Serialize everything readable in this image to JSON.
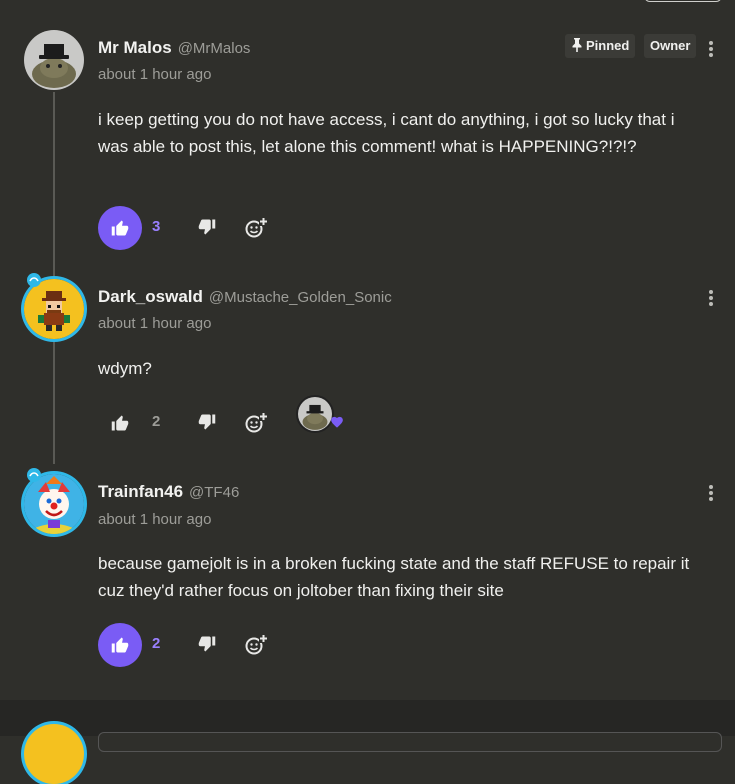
{
  "comments": [
    {
      "name": "Mr Malos",
      "handle": "@MrMalos",
      "time": "about 1 hour ago",
      "text": "i keep getting you do not have access, i cant do anything, i got so lucky that i was able to post this, let alone this comment! what is HAPPENING?!?!?",
      "likes": "3",
      "liked": true,
      "tags": {
        "pinned": "Pinned",
        "owner": "Owner"
      }
    },
    {
      "name": "Dark_oswald",
      "handle": "@Mustache_Golden_Sonic",
      "time": "about 1 hour ago",
      "text": "wdym?",
      "likes": "2",
      "liked": false
    },
    {
      "name": "Trainfan46",
      "handle": "@TF46",
      "time": "about 1 hour ago",
      "text": "because gamejolt is in a broken fucking state and the staff REFUSE to repair it cuz they'd rather focus on joltober than fixing their site",
      "likes": "2",
      "liked": true
    }
  ],
  "colors": {
    "background": "#2f2f2b",
    "accent": "#7a5cf5",
    "accent_text": "#9a80ff",
    "frame_ring": "#2fb8e8",
    "muted_text": "#9d9d98"
  },
  "icons": [
    "thumbs-up-icon",
    "thumbs-down-icon",
    "add-reaction-icon",
    "kebab-menu-icon",
    "pin-icon",
    "heart-icon"
  ]
}
